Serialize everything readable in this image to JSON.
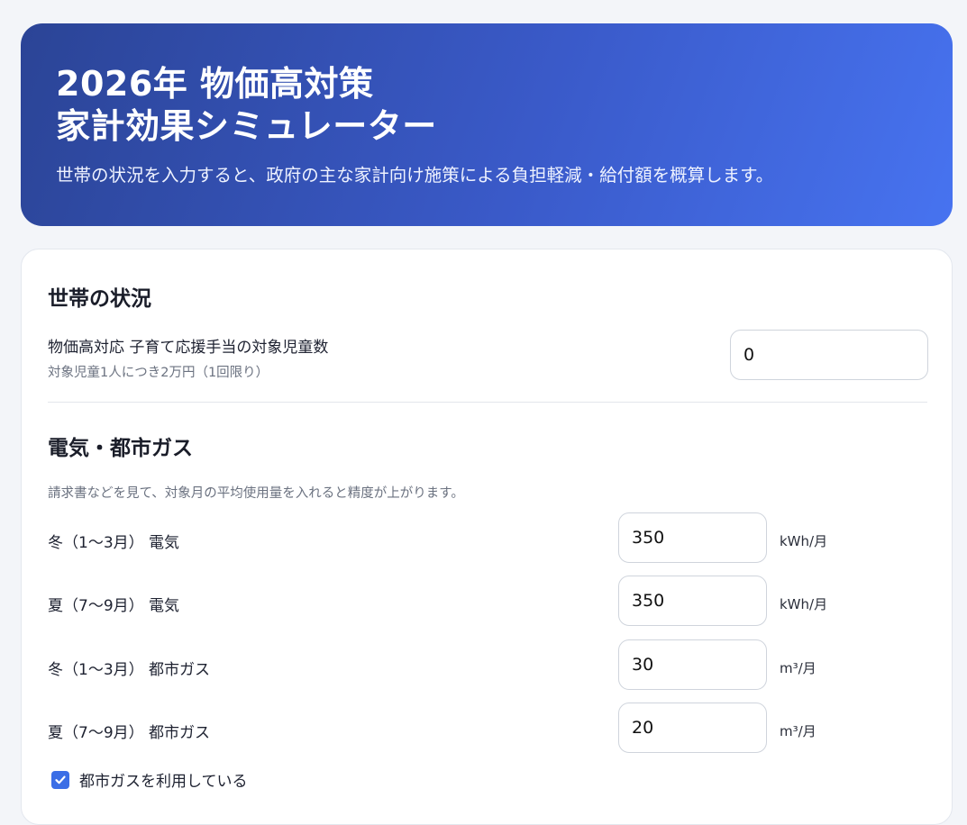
{
  "header": {
    "title_line1": "2026年 物価高対策",
    "title_line2": "家計効果シミュレーター",
    "subtitle": "世帯の状況を入力すると、政府の主な家計向け施策による負担軽減・給付額を概算します。"
  },
  "household": {
    "section_title": "世帯の状況",
    "child_label": "物価高対応 子育て応援手当の対象児童数",
    "child_note": "対象児童1人につき2万円（1回限り）",
    "child_value": "0"
  },
  "energy": {
    "section_title": "電気・都市ガス",
    "note": "請求書などを見て、対象月の平均使用量を入れると精度が上がります。",
    "rows": [
      {
        "label": "冬（1〜3月） 電気",
        "value": "350",
        "unit": "kWh/月"
      },
      {
        "label": "夏（7〜9月） 電気",
        "value": "350",
        "unit": "kWh/月"
      },
      {
        "label": "冬（1〜3月） 都市ガス",
        "value": "30",
        "unit": "m³/月"
      },
      {
        "label": "夏（7〜9月） 都市ガス",
        "value": "20",
        "unit": "m³/月"
      }
    ],
    "gas_checkbox_label": "都市ガスを利用している",
    "gas_checkbox_checked": true
  },
  "colors": {
    "hero_start": "#2b4496",
    "hero_end": "#4773f0",
    "accent": "#3b6ee6"
  }
}
